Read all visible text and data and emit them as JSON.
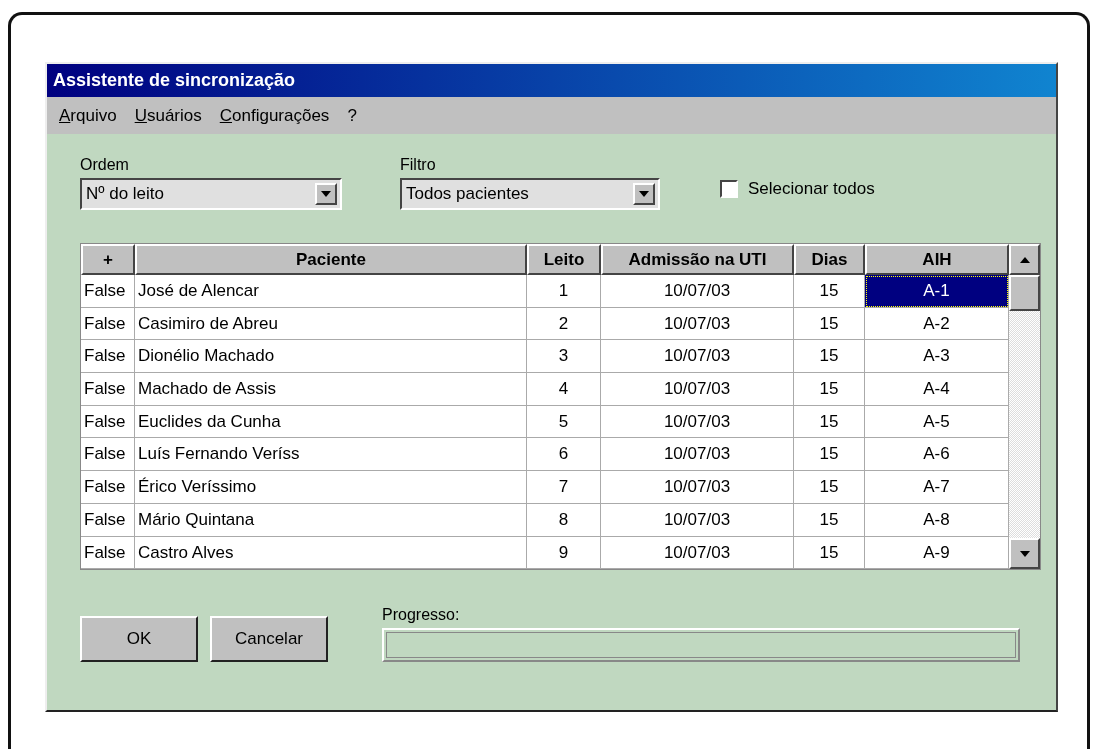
{
  "window": {
    "title": "Assistente de sincronização"
  },
  "menu": [
    {
      "label": "Arquivo",
      "underlined_initial": true
    },
    {
      "label": "Usuários",
      "underlined_initial": true
    },
    {
      "label": "Configurações",
      "underlined_initial": true
    },
    {
      "label": "?",
      "underlined_initial": false
    }
  ],
  "order": {
    "label": "Ordem",
    "value": "Nº do leito"
  },
  "filter": {
    "label": "Filtro",
    "value": "Todos pacientes"
  },
  "select_all": {
    "label": "Selecionar todos",
    "checked": false
  },
  "table": {
    "columns": [
      "+",
      "Paciente",
      "Leito",
      "Admissão na UTI",
      "Dias",
      "AIH"
    ],
    "rows": [
      {
        "cells": [
          "False",
          "José de Alencar",
          "1",
          "10/07/03",
          "15",
          "A-1"
        ],
        "selected": true
      },
      {
        "cells": [
          "False",
          "Casimiro de Abreu",
          "2",
          "10/07/03",
          "15",
          "A-2"
        ],
        "selected": false
      },
      {
        "cells": [
          "False",
          "Dionélio Machado",
          "3",
          "10/07/03",
          "15",
          "A-3"
        ],
        "selected": false
      },
      {
        "cells": [
          "False",
          "Machado de Assis",
          "4",
          "10/07/03",
          "15",
          "A-4"
        ],
        "selected": false
      },
      {
        "cells": [
          "False",
          "Euclides da Cunha",
          "5",
          "10/07/03",
          "15",
          "A-5"
        ],
        "selected": false
      },
      {
        "cells": [
          "False",
          "Luís Fernando Veríss",
          "6",
          "10/07/03",
          "15",
          "A-6"
        ],
        "selected": false
      },
      {
        "cells": [
          "False",
          "Érico Veríssimo",
          "7",
          "10/07/03",
          "15",
          "A-7"
        ],
        "selected": false
      },
      {
        "cells": [
          "False",
          "Mário Quintana",
          "8",
          "10/07/03",
          "15",
          "A-8"
        ],
        "selected": false
      },
      {
        "cells": [
          "False",
          "Castro Alves",
          "9",
          "10/07/03",
          "15",
          "A-9"
        ],
        "selected": false
      }
    ]
  },
  "buttons": [
    "OK",
    "Cancelar"
  ],
  "progress": {
    "label": "Progresso:"
  }
}
